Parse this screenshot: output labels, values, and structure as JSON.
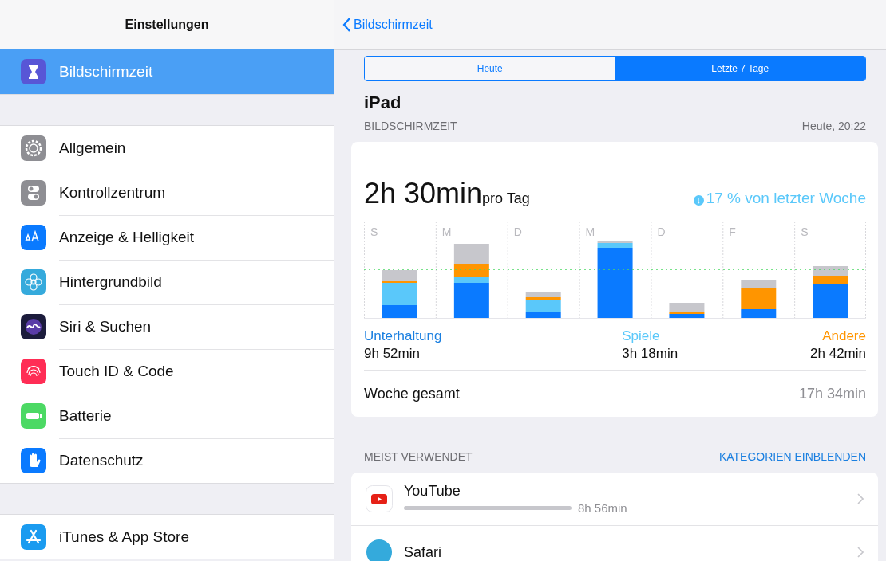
{
  "sidebar": {
    "title": "Einstellungen",
    "groups": [
      [
        {
          "label": "Bildschirmzeit",
          "selected": true
        }
      ],
      [
        {
          "label": "Allgemein",
          "selected": false
        },
        {
          "label": "Kontrollzentrum",
          "selected": false
        },
        {
          "label": "Anzeige & Helligkeit",
          "selected": false
        },
        {
          "label": "Hintergrundbild",
          "selected": false
        },
        {
          "label": "Siri & Suchen",
          "selected": false
        },
        {
          "label": "Touch ID & Code",
          "selected": false
        },
        {
          "label": "Batterie",
          "selected": false
        },
        {
          "label": "Datenschutz",
          "selected": false
        }
      ],
      [
        {
          "label": "iTunes & App Store",
          "selected": false
        }
      ]
    ]
  },
  "nav": {
    "back": "Bildschirmzeit"
  },
  "segments": [
    {
      "label": "Heute",
      "selected": false
    },
    {
      "label": "Letzte 7 Tage",
      "selected": true
    }
  ],
  "device": "iPad",
  "section": {
    "title": "BILDSCHIRMZEIT",
    "time": "Heute, 20:22"
  },
  "summary": {
    "value": "2h 30min",
    "unit": "pro Tag",
    "change_icon": "↓",
    "change": "17 % von letzter Woche"
  },
  "days": [
    "S",
    "M",
    "D",
    "M",
    "D",
    "F",
    "S"
  ],
  "legend": [
    {
      "label": "Unterhaltung",
      "value": "9h 52min",
      "color": "#1a7fe0"
    },
    {
      "label": "Spiele",
      "value": "3h 18min",
      "color": "#5ac8fa"
    },
    {
      "label": "Andere",
      "value": "2h 42min",
      "color": "#ff9500"
    }
  ],
  "total": {
    "label": "Woche gesamt",
    "value": "17h 34min"
  },
  "most_used": {
    "title": "MEIST VERWENDET",
    "action": "KATEGORIEN EINBLENDEN",
    "apps": [
      {
        "name": "YouTube",
        "time": "8h 56min"
      },
      {
        "name": "Safari"
      }
    ]
  }
}
